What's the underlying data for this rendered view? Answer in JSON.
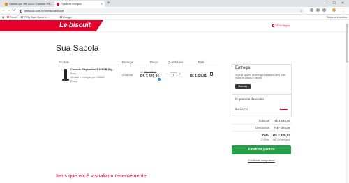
{
  "browser": {
    "tabs": [
      {
        "title": "Saindo por R$ 2029: Console PS...",
        "active": false
      },
      {
        "title": "Finalizar compra",
        "active": true
      }
    ],
    "url": "lebiscuit.com.br/checkout/#/cart",
    "bookmarks": [
      {
        "label": "Gmail",
        "icon": "mail-icon"
      },
      {
        "label": "RPS | Base Canal d...",
        "icon": "app-icon"
      },
      {
        "label": "Chatgpt",
        "icon": "sparkle-icon"
      }
    ],
    "bookmarks_right": "Todos os favoritos",
    "colors": {
      "tabbar": "#dee1e6"
    }
  },
  "site": {
    "logo": "Le biscuit",
    "secure_label": "100% Seguro",
    "brand_color": "#e4002b"
  },
  "cart": {
    "title": "Sua Sacola",
    "columns": {
      "produto": "Produto",
      "entrega": "Entrega",
      "preco": "Preço",
      "quantidade": "Quantidade",
      "total": "Total"
    },
    "item": {
      "name": "Console Playstation 5 825GB Dig...",
      "brand": "Sony",
      "seller": "Vendido e entregue por: CASAS",
      "remove_label": "Excluir",
      "delivery": "A calcular",
      "old_price_prefix": "De:",
      "old_price": "R$ 4.499,00",
      "price": "R$ 3.329,91",
      "quantity": "1",
      "total": "R$ 3.329,91"
    }
  },
  "delivery_panel": {
    "title": "Entrega",
    "description": "Veja as opções de entrega para seus itens, com todos os prazos e valores.",
    "calc_button": "Calcular"
  },
  "coupon": {
    "title": "Cupom de desconto",
    "code": "BLECAP99",
    "value": "Excluir"
  },
  "summary": {
    "subtotal_label": "Subtotal",
    "subtotal": "R$ 3.699,90",
    "discount_label": "Descontos",
    "discount": "R$ - 369,99",
    "total_label": "Total",
    "total": "R$ 3.329,91",
    "installments_label": "12 vezes",
    "installments": "até 12x sem juros",
    "checkout_button": "Finalizar pedido",
    "continue_link": "Continuar comprando"
  },
  "recent": {
    "title": "Itens que você visualizou recentemente"
  }
}
